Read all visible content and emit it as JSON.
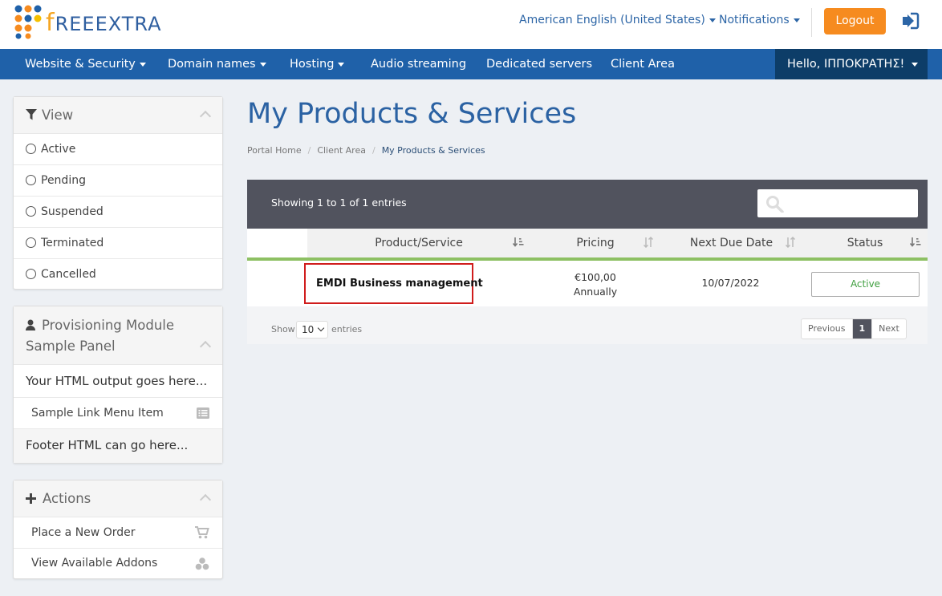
{
  "header": {
    "logo_text_f": "f",
    "logo_text_rest": "REEEXTRA",
    "language": "American English (United States)",
    "notifications": "Notifications",
    "logout_label": "Logout"
  },
  "nav": {
    "items": [
      "Website & Security",
      "Domain names",
      "Hosting",
      "Audio streaming",
      "Dedicated servers",
      "Client Area"
    ],
    "user_greeting": "Hello, ΙΠΠΟΚΡΑΤΗΣ!"
  },
  "sidebar": {
    "view": {
      "title": "View",
      "items": [
        "Active",
        "Pending",
        "Suspended",
        "Terminated",
        "Cancelled"
      ]
    },
    "provisioning": {
      "title_line1": "Provisioning Module",
      "title_line2": "Sample Panel",
      "body": "Your HTML output goes here...",
      "link": "Sample Link Menu Item",
      "footer": "Footer HTML can go here..."
    },
    "actions": {
      "title": "Actions",
      "items": [
        "Place a New Order",
        "View Available Addons"
      ]
    }
  },
  "main": {
    "title": "My Products & Services",
    "breadcrumb": [
      "Portal Home",
      "Client Area",
      "My Products & Services"
    ],
    "showing": "Showing 1 to 1 of 1 entries",
    "columns": [
      "Product/Service",
      "Pricing",
      "Next Due Date",
      "Status"
    ],
    "rows": [
      {
        "product": "EMDI Business management",
        "price": "€100,00",
        "cycle": "Annually",
        "due": "10/07/2022",
        "status": "Active"
      }
    ],
    "length_label_show": "Show",
    "length_value": "10",
    "length_label_entries": "entries",
    "pager": {
      "prev": "Previous",
      "page": "1",
      "next": "Next"
    }
  },
  "colors": {
    "nav_bg": "#1f61a9",
    "user_bg": "#0d3d68",
    "logout_bg": "#f68b1f",
    "table_head_bg": "#51535e",
    "accent_green": "#8dc063",
    "status_green": "#3f9f3f"
  }
}
